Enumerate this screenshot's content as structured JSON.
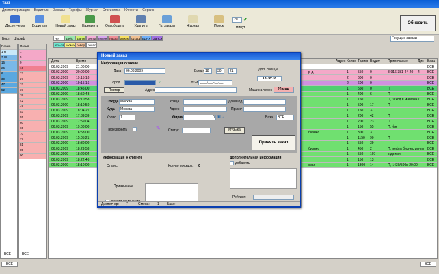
{
  "window": {
    "title": "Taxi"
  },
  "menu": [
    "Диспетчеризация",
    "Водители",
    "Заказы",
    "Тарифы",
    "Журнал",
    "Статистика",
    "Клиенты",
    "Сервис"
  ],
  "toolbar": {
    "buttons": [
      {
        "label": "Диспетчеры",
        "icon": "dispatchers-icon",
        "color": "#3a6fd0"
      },
      {
        "label": "Водители",
        "icon": "drivers-icon",
        "color": "#5a8fe0"
      },
      {
        "label": "Новый заказ",
        "icon": "new-order-icon",
        "color": "#f0e090"
      },
      {
        "label": "Назначить",
        "icon": "assign-icon",
        "color": "#4a9a4a"
      },
      {
        "label": "Освободить",
        "icon": "release-icon",
        "color": "#d05050"
      },
      {
        "label": "Удалить",
        "icon": "delete-icon",
        "color": "#6080b0"
      },
      {
        "label": "Гр. заказы",
        "icon": "group-orders-icon",
        "color": "#6aa0d8"
      },
      {
        "label": "Журнал",
        "icon": "journal-icon",
        "color": "#e0d8b0"
      },
      {
        "label": "Поиск",
        "icon": "search-icon",
        "color": "#d8c080"
      }
    ],
    "timer_value": "20",
    "timer_unit": "минут",
    "refresh_label": "Обновить"
  },
  "orders_filter": "Текущие заказы",
  "left_tabs": [
    "Борт",
    "Штраф"
  ],
  "categories": [
    {
      "label": "Нет",
      "color": "#ffffff"
    },
    {
      "label": "шейк",
      "color": "#9be8b0"
    },
    {
      "label": "шаляп",
      "color": "#d0f070"
    },
    {
      "label": "центр",
      "color": "#f4b0d8"
    },
    {
      "label": "поляна",
      "color": "#d8a8f0"
    },
    {
      "label": "город",
      "color": "#f09098"
    },
    {
      "label": "авиакасс",
      "color": "#f8e060"
    },
    {
      "label": "сухарики",
      "color": "#f0c090"
    },
    {
      "label": "ВДНХ",
      "color": "#70b0f8"
    },
    {
      "label": "ЗапСиб",
      "color": "#a070e0"
    },
    {
      "label": "юго-запад",
      "color": "#70e8d0"
    },
    {
      "label": "космос",
      "color": "#f8f080"
    },
    {
      "label": "север",
      "color": "#f8c8a0"
    },
    {
      "label": "область",
      "color": "#ffffff"
    }
  ],
  "left1": {
    "header": "Позыв",
    "footer": "ВСЕ",
    "rows": [
      "1 Н",
      "7 НН",
      "15",
      "25",
      "6",
      "39",
      "47",
      "52"
    ]
  },
  "left2": {
    "header": "Позыв",
    "footer": "ВСЕ",
    "rows": [
      "1",
      "5",
      "9",
      "16",
      "23",
      "27",
      "32",
      "37",
      "39",
      "42",
      "48",
      "53",
      "55",
      "60",
      "65",
      "70",
      "77",
      "81",
      "85",
      "90"
    ]
  },
  "grid": {
    "headers": [
      "Дата",
      "Время",
      "Адрес",
      "Колво",
      "Тариф",
      "Водит",
      "Примечание",
      "Дис",
      "База"
    ],
    "rows": [
      {
        "date": "06.03.2009",
        "time": "21:00:00",
        "addr": "",
        "qty": "",
        "tariff": "",
        "driver": "",
        "note": "",
        "dis": "",
        "base": "ВСЕ",
        "bg": "#ffffff"
      },
      {
        "date": "06.03.2009",
        "time": "20:00:00",
        "addr": "р-д",
        "qty": "1",
        "tariff": "550",
        "driver": "0",
        "note": "8-916-381-44-20",
        "dis": "4",
        "base": "ВСЕ",
        "bg": "#f4a8c8"
      },
      {
        "date": "06.03.2009",
        "time": "19:15:18",
        "addr": "",
        "qty": "2",
        "tariff": "600",
        "driver": "0",
        "note": "",
        "dis": "",
        "base": "ВСЕ",
        "bg": "#f4a8c8"
      },
      {
        "date": "06.03.2009",
        "time": "19:15:16",
        "addr": "",
        "qty": "2",
        "tariff": "600",
        "driver": "0",
        "note": "",
        "dis": "",
        "base": "ВСЕ",
        "bg": "#d090e0"
      },
      {
        "date": "06.03.2009",
        "time": "18:45:00",
        "addr": "",
        "qty": "1",
        "tariff": "550",
        "driver": "0",
        "note": "П",
        "dis": "",
        "base": "ВСЕ",
        "bg": "#50d070"
      },
      {
        "date": "06.03.2009",
        "time": "18:50:43",
        "addr": "",
        "qty": "1",
        "tariff": "400",
        "driver": "6",
        "note": "П",
        "dis": "",
        "base": "ВСЕ",
        "bg": "#70e070"
      },
      {
        "date": "06.03.2009",
        "time": "18:10:58",
        "addr": "",
        "qty": "1",
        "tariff": "750",
        "driver": "1",
        "note": "П, заход в магазин",
        "dis": "7",
        "base": "ВСЕ",
        "bg": "#70e070"
      },
      {
        "date": "06.03.2009",
        "time": "18:10:50",
        "addr": "",
        "qty": "1",
        "tariff": "500",
        "driver": "17",
        "note": "П",
        "dis": "",
        "base": "ВСЕ",
        "bg": "#70e070"
      },
      {
        "date": "06.03.2009",
        "time": "18:04:21",
        "addr": "",
        "qty": "1",
        "tariff": "150",
        "driver": "37",
        "note": "",
        "dis": "",
        "base": "ВСЕ",
        "bg": "#70e070"
      },
      {
        "date": "06.03.2009",
        "time": "17:39:39",
        "addr": "",
        "qty": "1",
        "tariff": "200",
        "driver": "42",
        "note": "П",
        "dis": "",
        "base": "ВСЕ",
        "bg": "#70e070"
      },
      {
        "date": "06.03.2009",
        "time": "17:59:04",
        "addr": "",
        "qty": "1",
        "tariff": "200",
        "driver": "23",
        "note": "П",
        "dis": "",
        "base": "ВСЕ",
        "bg": "#70e070"
      },
      {
        "date": "06.03.2009",
        "time": "19:00:00",
        "addr": "",
        "qty": "1",
        "tariff": "150",
        "driver": "55",
        "note": "П, б/н",
        "dis": "",
        "base": "ВСЕ",
        "bg": "#70e070"
      },
      {
        "date": "06.03.2009",
        "time": "16:53:00",
        "addr": "бизнес",
        "qty": "1",
        "tariff": "300",
        "driver": "3",
        "note": "",
        "dis": "",
        "base": "ВСЕ",
        "bg": "#70e070"
      },
      {
        "date": "06.03.2009",
        "time": "15:05:21",
        "addr": "",
        "qty": "1",
        "tariff": "1150",
        "driver": "90",
        "note": "П",
        "dis": "",
        "base": "ВСЕ",
        "bg": "#70e070"
      },
      {
        "date": "06.03.2009",
        "time": "18:30:00",
        "addr": "",
        "qty": "1",
        "tariff": "550",
        "driver": "39",
        "note": "",
        "dis": "",
        "base": "ВСЕ",
        "bg": "#70e070"
      },
      {
        "date": "06.03.2009",
        "time": "18:29:53",
        "addr": "бизнес",
        "qty": "1",
        "tariff": "450",
        "driver": "2",
        "note": "П, нефть бизнес центр",
        "dis": "",
        "base": "ВСЕ",
        "bg": "#70e070"
      },
      {
        "date": "06.03.2009",
        "time": "18:20:04",
        "addr": "",
        "qty": "1",
        "tariff": "550",
        "driver": "107",
        "note": "с дрими",
        "dis": "",
        "base": "ВСЕ",
        "bg": "#70e070"
      },
      {
        "date": "06.03.2009",
        "time": "18:22:46",
        "addr": "",
        "qty": "1",
        "tariff": "150",
        "driver": "13",
        "note": "",
        "dis": "",
        "base": "ВСЕ",
        "bg": "#70e070"
      },
      {
        "date": "06.03.2009",
        "time": "18:10:00",
        "addr": "ская",
        "qty": "1",
        "tariff": "1300",
        "driver": "14",
        "note": "П, 1430/500в 20:00",
        "dis": "",
        "base": "ВСЕ",
        "bg": "#70e070"
      }
    ]
  },
  "dialog": {
    "title": "Новый заказ",
    "order_info": "Информация о заказе",
    "date_label": "Дата",
    "date_value": "06.03.2009",
    "time_label": "Время",
    "time_h": "18",
    "time_m": "30",
    "time_s": "21",
    "prelim_label": "Доп. смещ-е",
    "prelim_time": "18:38:38",
    "phone_label": "Город",
    "cell_label": "Сот-й",
    "cell_value": "(___)___-__-__",
    "repeat_btn": "Повтор",
    "address_label": "Адрес",
    "wait_label": "Машина через",
    "wait_value": "20 мин.",
    "from_label": "Откуда",
    "from_value": "Москва",
    "street_label": "Улица",
    "house_label": "Дом/Под",
    "to_label": "Куда",
    "to_value": "Москва",
    "addr2_label": "Адрес",
    "note_label": "Примеч",
    "qty_label": "Колво",
    "qty_value": "1",
    "tariff_label": "Фирма",
    "tariff_value": "0",
    "base_label": "База",
    "base_value": "ВСЕ",
    "recall_label": "Перезвонить",
    "status_label": "Статус",
    "music_btn": "Музыка",
    "accept_btn": "Принять заказ",
    "client_info": "Информация о клиенте",
    "client_status_label": "Статус:",
    "trips_label": "Кол-во поездок:",
    "trips_value": "0",
    "client_note_label": "Примечание",
    "save_changes_label": "Внести изменения",
    "extra_info": "Дополнительная информация",
    "add_label": "добавить",
    "rating_label": "Рейтинг:",
    "footer_disp_label": "Диспетчер:",
    "footer_disp_value": "7",
    "footer_shift_label": "Смена:",
    "footer_shift_value": "1",
    "footer_base_label": "База:"
  },
  "status_bar": {
    "left": "ВСЕ",
    "right": "ВСЕ"
  }
}
